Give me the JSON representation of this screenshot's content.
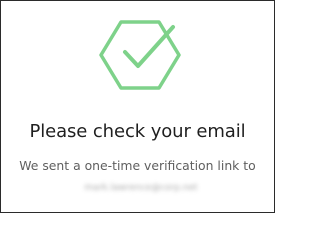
{
  "icon": {
    "name": "hexagon-check-icon",
    "color": "#7ed28a"
  },
  "heading": "Please check your email",
  "message": "We sent a one-time verification link to",
  "email": "mark.lawrence@corp.net",
  "colors": {
    "text_primary": "#1f1f1f",
    "text_secondary": "#5f5f5f",
    "accent": "#7ed28a",
    "border": "#2b2b2b"
  }
}
